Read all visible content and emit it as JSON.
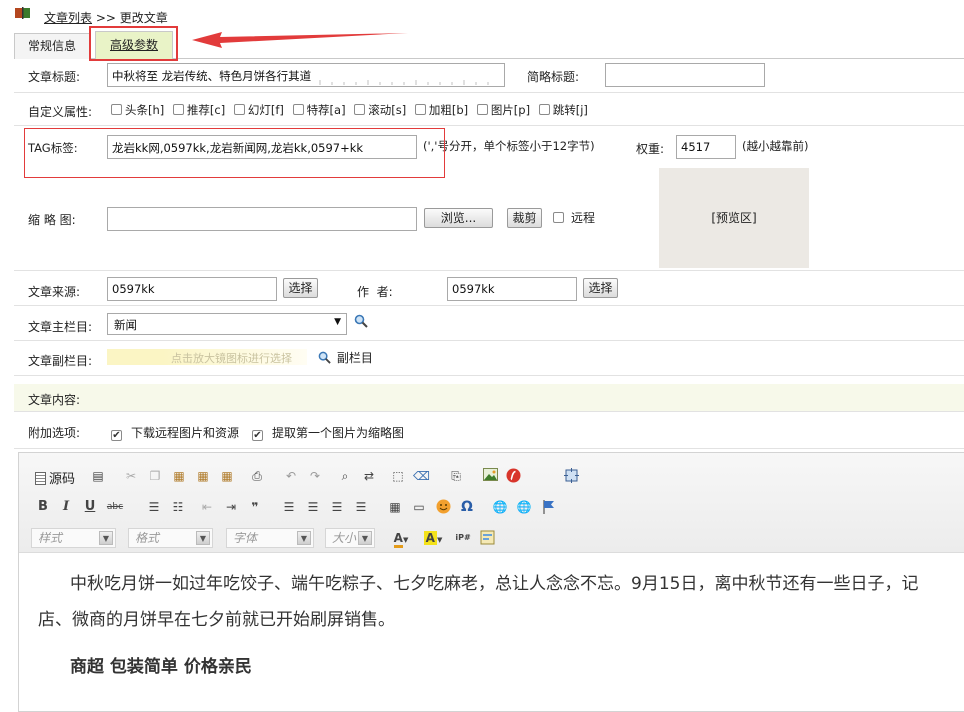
{
  "breadcrumb": {
    "list": "文章列表",
    "sep": ">>",
    "current": "更改文章"
  },
  "tabs": [
    {
      "label": "常规信息"
    },
    {
      "label": "高级参数"
    }
  ],
  "form": {
    "title_label": "文章标题:",
    "title_value": "中秋将至 龙岩传统、特色月饼各行其道",
    "short_title_label": "简略标题:",
    "short_title_value": "",
    "attr_label": "自定义属性:",
    "attrs": [
      "头条[h]",
      "推荐[c]",
      "幻灯[f]",
      "特荐[a]",
      "滚动[s]",
      "加粗[b]",
      "图片[p]",
      "跳转[j]"
    ],
    "tag_label": "TAG标签:",
    "tag_value": "龙岩kk网,0597kk,龙岩新闻网,龙岩kk,0597+kk",
    "tag_hint": "(','号分开，单个标签小于12字节)",
    "weight_label": "权重:",
    "weight_value": "4517",
    "weight_hint": "(越小越靠前)",
    "thumb_label": "缩 略 图:",
    "thumb_value": "",
    "browse_button": "浏览...",
    "crop_button": "裁剪",
    "remote_label": "远程",
    "preview_label": "[预览区]",
    "source_label": "文章来源:",
    "source_value": "0597kk",
    "choose_button": "选择",
    "author_label": "作  者:",
    "author_value": "0597kk",
    "main_col_label": "文章主栏目:",
    "main_col_value": "新闻",
    "sub_col_label": "文章副栏目:",
    "sub_col_hint": "点击放大镜图标进行选择",
    "sub_col_link": "副栏目",
    "content_label": "文章内容:",
    "extra_label": "附加选项:",
    "opt_download": "下载远程图片和资源",
    "opt_first_image": "提取第一个图片为缩略图"
  },
  "editor": {
    "source_button": "源码",
    "combos": [
      "样式",
      "格式",
      "字体",
      "大小"
    ],
    "paragraph1": "中秋吃月饼一如过年吃饺子、端午吃粽子、七夕吃麻老，总让人念念不忘。9月15日，离中秋节还有一些日子，记",
    "paragraph1_cont": "店、微商的月饼早在七夕前就已开始刷屏销售。",
    "heading": "商超 包装简单 价格亲民"
  },
  "colors": {
    "highlight": "#e23b3b",
    "tab_active_bg": "#e9f3c7",
    "content_row_bg": "#f7f9ea"
  }
}
